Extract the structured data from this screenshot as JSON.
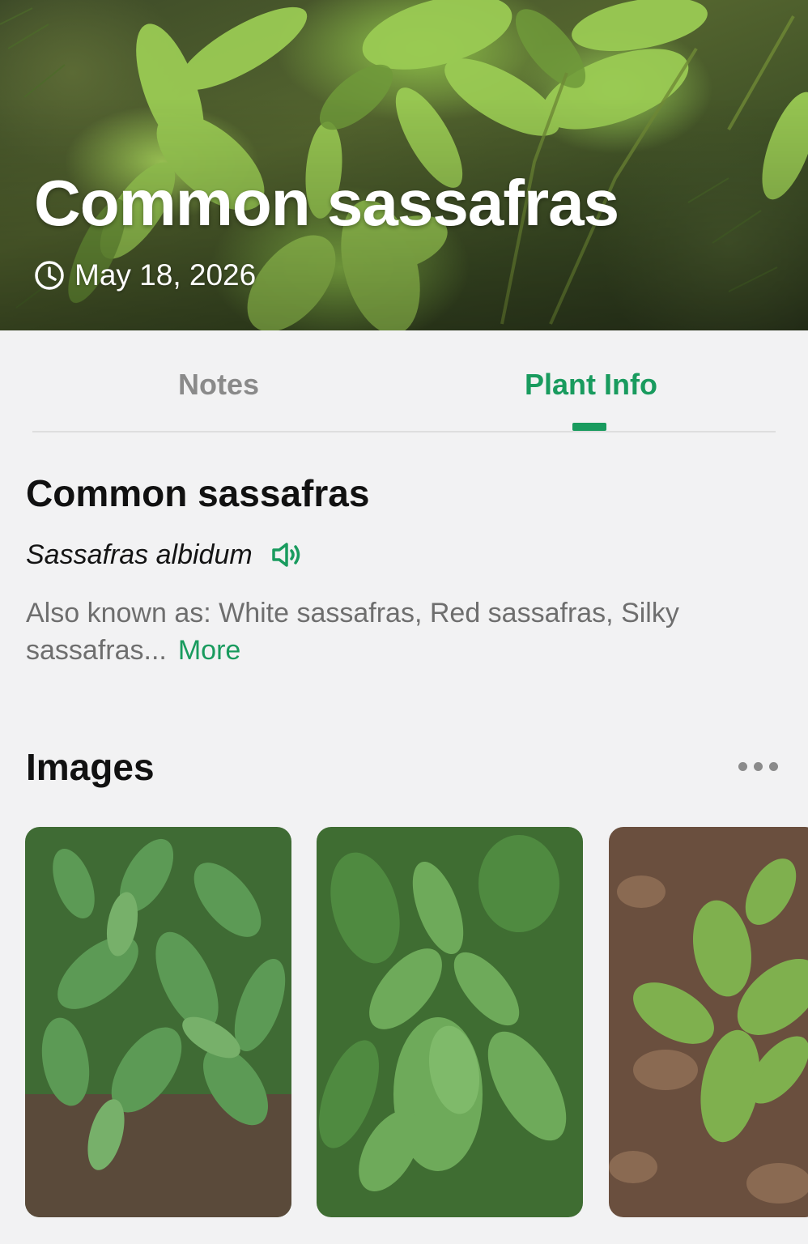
{
  "hero": {
    "title": "Common sassafras",
    "date": "May 18, 2026",
    "date_icon": "clock-icon"
  },
  "tabs": [
    {
      "label": "Notes",
      "active": false
    },
    {
      "label": "Plant Info",
      "active": true
    }
  ],
  "plant": {
    "common_name": "Common sassafras",
    "scientific_name": "Sassafras albidum",
    "pronounce_icon": "speaker-icon",
    "also_known_as": "Also known as: White sassafras, Red sassafras, Silky sassafras...",
    "more_label": "More"
  },
  "images_section": {
    "title": "Images",
    "more_icon": "more-dots-icon",
    "thumbnail_count": 3
  },
  "colors": {
    "accent": "#199b5e",
    "muted_text": "#6e6e6e",
    "inactive_tab": "#8a8a8a",
    "background": "#f2f2f3"
  }
}
